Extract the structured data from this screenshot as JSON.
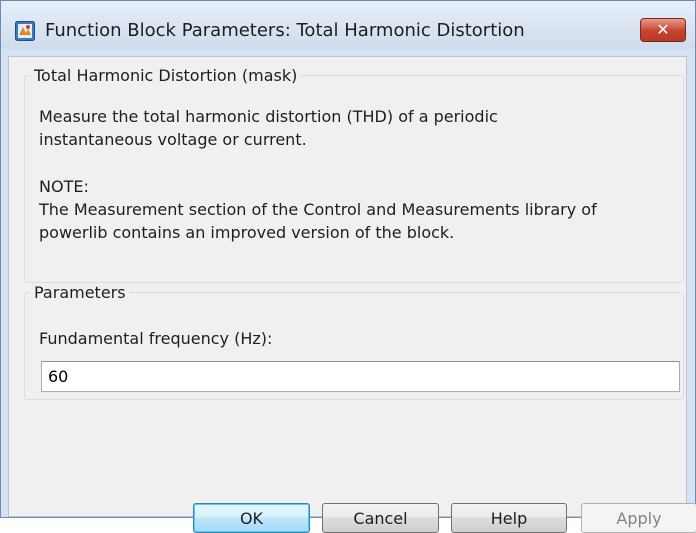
{
  "window": {
    "title": "Function Block Parameters: Total Harmonic Distortion",
    "close_label": "✕",
    "app_icon": "simulink-block-icon"
  },
  "mask": {
    "group_title": "Total Harmonic Distortion (mask)",
    "description_lines": [
      "Measure the total harmonic distortion (THD) of a periodic",
      "instantaneous voltage or current."
    ],
    "note_lines": [
      "NOTE:",
      "The Measurement section of the Control and Measurements library of",
      "powerlib contains an improved version of the block."
    ]
  },
  "parameters": {
    "group_title": "Parameters",
    "fundamental_frequency_label": "Fundamental frequency (Hz):",
    "fundamental_frequency_value": "60"
  },
  "buttons": {
    "ok": "OK",
    "cancel": "Cancel",
    "help": "Help",
    "apply": "Apply"
  },
  "colors": {
    "close_button": "#c6432f",
    "default_button_border": "#3c7fb1"
  }
}
